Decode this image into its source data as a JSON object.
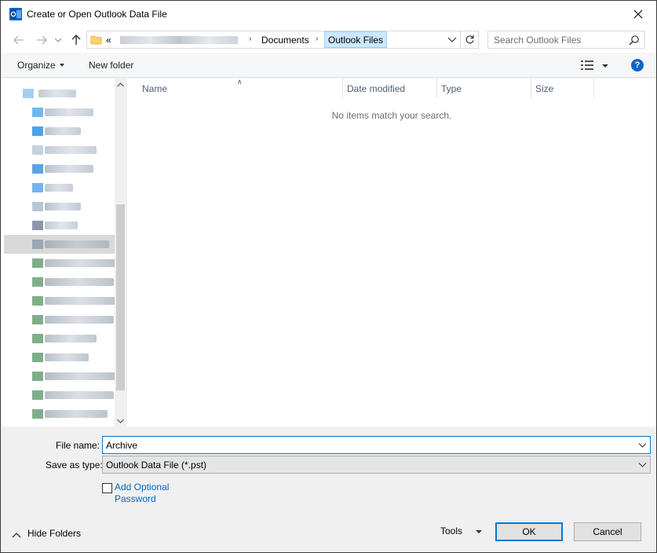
{
  "window": {
    "title": "Create or Open Outlook Data File",
    "close_icon": "close-icon"
  },
  "navigation": {
    "back_icon": "back-arrow-icon",
    "forward_icon": "forward-arrow-icon",
    "up_icon": "up-arrow-icon",
    "address": {
      "overflow": "«",
      "crumbs": [
        "Documents",
        "Outlook Files"
      ],
      "active_crumb": "Outlook Files"
    },
    "refresh_icon": "refresh-icon",
    "search": {
      "placeholder": "Search Outlook Files"
    }
  },
  "toolbar": {
    "organize_label": "Organize",
    "new_folder_label": "New folder",
    "help_label": "?"
  },
  "file_list": {
    "columns": [
      "Name",
      "Date modified",
      "Type",
      "Size"
    ],
    "empty_message": "No items match your search."
  },
  "form": {
    "file_name_label": "File name:",
    "file_name_value": "Archive",
    "save_as_type_label": "Save as type:",
    "save_as_type_value": "Outlook Data File (*.pst)",
    "add_password_label_line1": "Add Optional",
    "add_password_label_line2": "Password"
  },
  "footer": {
    "hide_folders_label": "Hide Folders",
    "tools_label": "Tools",
    "ok_label": "OK",
    "cancel_label": "Cancel"
  },
  "colors": {
    "accent": "#0078d7",
    "selection": "#cce8ff",
    "link": "#0066cc"
  }
}
